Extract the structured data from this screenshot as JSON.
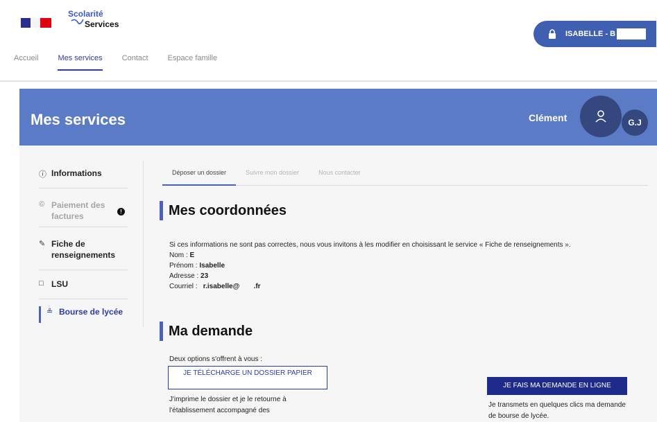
{
  "header": {
    "logo_top": "Scolarité",
    "logo_bottom": "Services",
    "nav": [
      "Accueil",
      "Mes services",
      "Contact",
      "Espace famille"
    ],
    "user_name": "ISABELLE - B"
  },
  "banner": {
    "title": "Mes services",
    "child_name": "Clément",
    "child_initials": "G.J"
  },
  "sidebar": {
    "items": [
      {
        "label": "Informations",
        "icon": "info-icon"
      },
      {
        "label": "Paiement des factures",
        "icon": "euro-icon",
        "badge": "!"
      },
      {
        "label": "Fiche de renseignements",
        "icon": "edit-icon"
      },
      {
        "label": "LSU",
        "icon": "book-icon"
      },
      {
        "label": "Bourse de lycée",
        "icon": "people-icon"
      }
    ]
  },
  "tabs": [
    "Déposer un dossier",
    "Suivre mon dossier",
    "Nous contacter"
  ],
  "coordonnees": {
    "title": "Mes coordonnées",
    "intro": "Si ces informations ne sont pas correctes, nous vous invitons à les modifier en choisissant le service « Fiche de renseignements ».",
    "nom_label": "Nom :",
    "nom_value": "E",
    "prenom_label": "Prénom :",
    "prenom_value": "Isabelle",
    "adresse_label": "Adresse :",
    "adresse_value": "23",
    "courriel_label": "Courriel :",
    "courriel_value_a": "r.isabelle@",
    "courriel_value_b": ".fr"
  },
  "demande": {
    "title": "Ma demande",
    "intro": "Deux options s'offrent à vous :",
    "option1_button": "JE TÉLÉCHARGE UN DOSSIER PAPIER",
    "option1_text_1": "J'imprime le dossier et je le retourne à",
    "option1_text_2": "l'établissement accompagné des",
    "option2_button": "JE FAIS MA DEMANDE EN LIGNE",
    "option2_text_1": "Je transmets en quelques clics ma demande",
    "option2_text_2": "de bourse de lycée."
  }
}
